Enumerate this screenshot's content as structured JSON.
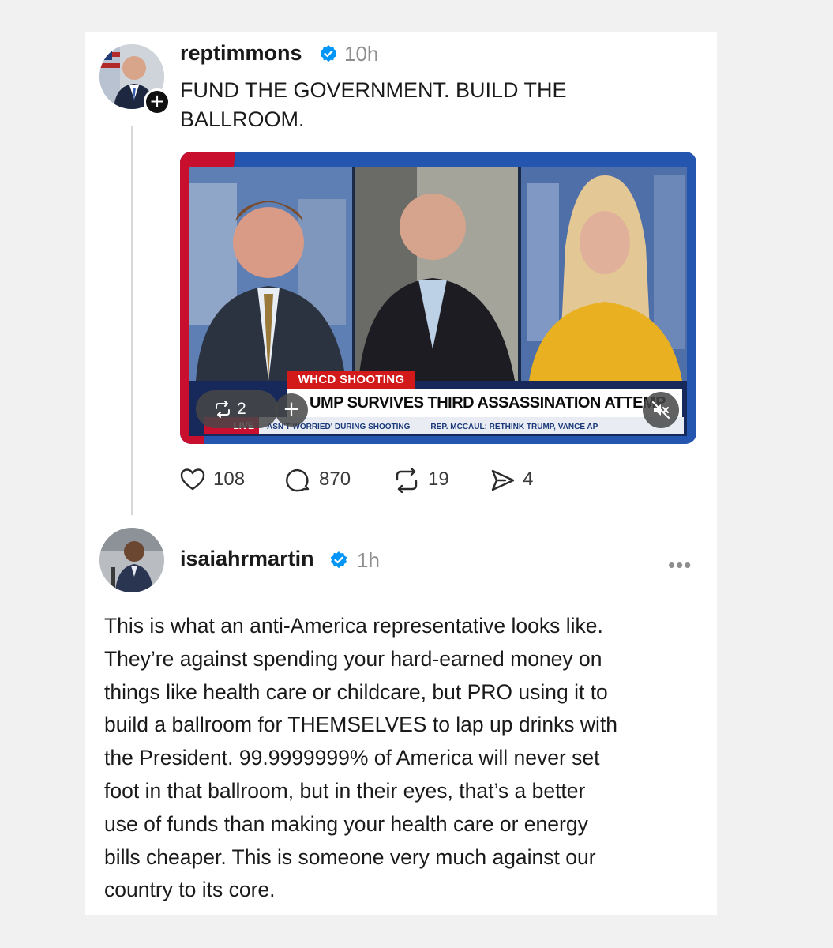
{
  "post1": {
    "username": "reptimmons",
    "time": "10h",
    "text": "FUND THE GOVERNMENT. BUILD THE\nBALLROOM.",
    "follow_symbol": "+",
    "media": {
      "tag": "WHCD SHOOTING",
      "headline": "UMP SURVIVES THIRD ASSASSINATION ATTEMP",
      "live_label": "LIVE",
      "ticker_left": "ASN'T WORRIED' DURING SHOOTING",
      "ticker_right": "REP. MCCAUL: RETHINK TRUMP, VANCE AP",
      "repost_count": "2",
      "plus_symbol": "+",
      "colors": {
        "frame": "#2456b0",
        "accent_red": "#d21a1a"
      }
    },
    "actions": {
      "likes": "108",
      "comments": "870",
      "reposts": "19",
      "shares": "4"
    }
  },
  "post2": {
    "username": "isaiahrmartin",
    "time": "1h",
    "more": "•••",
    "text": "This is what an anti-America representative looks like.\nThey’re against spending your hard-earned money on\nthings like health care or childcare, but PRO using it to\nbuild a ballroom for THEMSELVES to lap up drinks with\nthe President. 99.9999999% of America will never set\nfoot in that ballroom, but in their eyes, that’s a better\nuse of funds than making your health care or energy\nbills cheaper. This is someone very much against our\ncountry to its core."
  },
  "colors": {
    "verified": "#0095f6",
    "page_bg": "#f1f1f1"
  }
}
